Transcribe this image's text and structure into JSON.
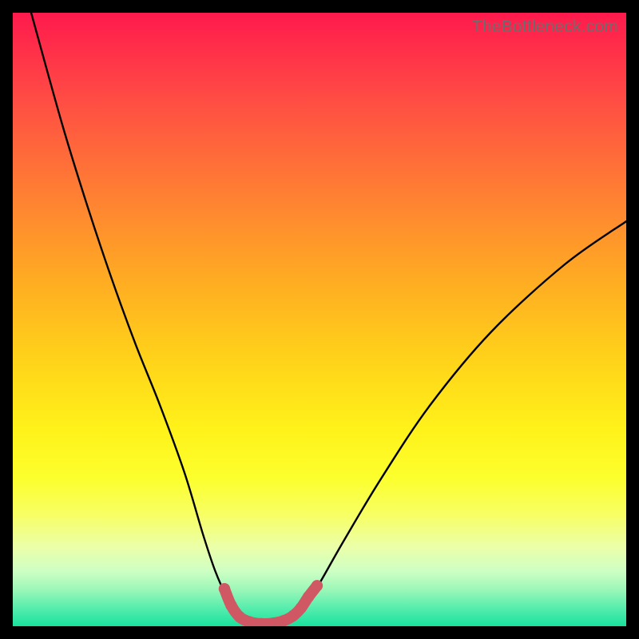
{
  "watermark": "TheBottleneck.com",
  "colors": {
    "background": "#000000",
    "curve": "#000000",
    "accent_band": "#cf5864",
    "watermark": "#6d6d6d"
  },
  "chart_data": {
    "type": "line",
    "title": "",
    "xlabel": "",
    "ylabel": "",
    "xlim": [
      0,
      100
    ],
    "ylim": [
      0,
      100
    ],
    "grid": false,
    "legend": false,
    "series": [
      {
        "name": "bottleneck-curve",
        "x": [
          3,
          8,
          12,
          16,
          20,
          24,
          28,
          31,
          33,
          35,
          36.5,
          38,
          40,
          42,
          44,
          46,
          48,
          50,
          54,
          60,
          68,
          78,
          90,
          100
        ],
        "y": [
          100,
          82,
          69,
          57,
          46,
          36,
          25,
          15,
          9,
          4.5,
          2,
          1,
          0.5,
          0.5,
          0.8,
          2,
          4,
          7,
          14,
          24,
          36,
          48,
          59,
          66
        ],
        "color": "#000000"
      }
    ],
    "annotations": [
      {
        "name": "optimal-range-band",
        "type": "curve-segment",
        "color": "#cf5864",
        "points_xy": [
          [
            34.5,
            6.1
          ],
          [
            35.6,
            3.4
          ],
          [
            37.0,
            1.5
          ],
          [
            38.6,
            0.7
          ],
          [
            40.5,
            0.4
          ],
          [
            42.5,
            0.5
          ],
          [
            44.2,
            0.9
          ],
          [
            45.7,
            1.7
          ],
          [
            47.0,
            3.0
          ],
          [
            48.2,
            4.8
          ],
          [
            49.6,
            6.6
          ]
        ]
      }
    ]
  }
}
